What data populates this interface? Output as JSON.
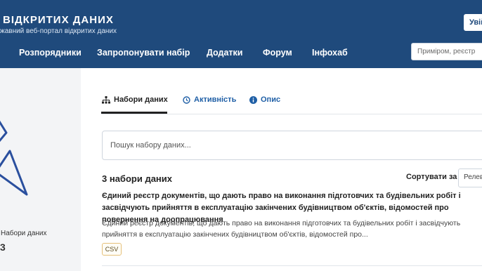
{
  "header": {
    "title": "ВІДКРИТИХ ДАНИХ",
    "subtitle": "жавний веб-портал відкритих даних",
    "login_label": "Увійти",
    "search_placeholder": "Приміром, реєстр"
  },
  "nav": {
    "items": [
      {
        "label": "Розпорядники"
      },
      {
        "label": "Запропонувати набір"
      },
      {
        "label": "Додатки"
      },
      {
        "label": "Форум"
      },
      {
        "label": "Інфохаб"
      }
    ]
  },
  "sidebar": {
    "stat_label": "Набори даних",
    "stat_value": "3"
  },
  "tabs": [
    {
      "label": "Набори даних",
      "icon": "sitemap-icon",
      "active": true
    },
    {
      "label": "Активність",
      "icon": "clock-icon",
      "active": false
    },
    {
      "label": "Опис",
      "icon": "info-icon",
      "active": false
    }
  ],
  "dataset_search": {
    "placeholder": "Пошук набору даних..."
  },
  "results": {
    "count_label": "3 набори даних",
    "sort_label": "Сортувати за",
    "sort_value": "Релевантністю"
  },
  "datasets": [
    {
      "title": "Єдиний реєстр документів, що дають право на виконання підготовчих та будівельних робіт і засвідчують прийняття в експлуатацію закінчених будівництвом об'єктів, відомостей про повернення на доопрацювання",
      "description": "Єдиний реєстр документів, що дають право на виконання підготовчих та будівельних робіт і засвідчують прийняття в експлуатацію закінчених будівництвом об'єктів, відомостей про...",
      "format": "CSV"
    }
  ],
  "colors": {
    "header_bg": "#1f4a7c",
    "link": "#1f5fa6",
    "sidebar_bg": "#f3f4f6"
  }
}
